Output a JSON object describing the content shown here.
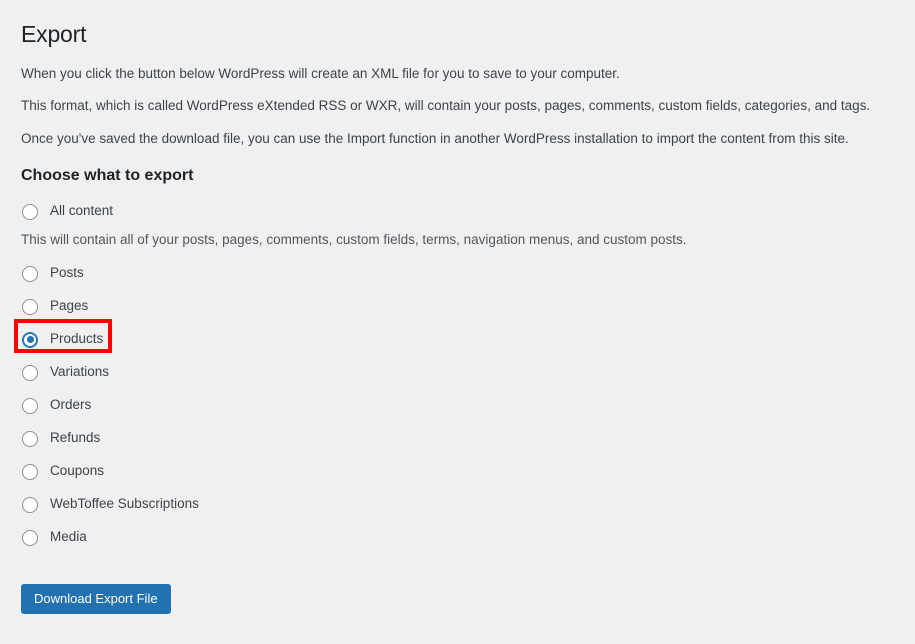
{
  "page": {
    "title": "Export",
    "intro_paragraphs": [
      "When you click the button below WordPress will create an XML file for you to save to your computer.",
      "This format, which is called WordPress eXtended RSS or WXR, will contain your posts, pages, comments, custom fields, categories, and tags.",
      "Once you've saved the download file, you can use the Import function in another WordPress installation to import the content from this site."
    ],
    "section_title": "Choose what to export",
    "all_content_description": "This will contain all of your posts, pages, comments, custom fields, terms, navigation menus, and custom posts.",
    "download_button_label": "Download Export File"
  },
  "options": [
    {
      "label": "All content",
      "selected": false
    },
    {
      "label": "Posts",
      "selected": false
    },
    {
      "label": "Pages",
      "selected": false
    },
    {
      "label": "Products",
      "selected": true
    },
    {
      "label": "Variations",
      "selected": false
    },
    {
      "label": "Orders",
      "selected": false
    },
    {
      "label": "Refunds",
      "selected": false
    },
    {
      "label": "Coupons",
      "selected": false
    },
    {
      "label": "WebToffee Subscriptions",
      "selected": false
    },
    {
      "label": "Media",
      "selected": false
    }
  ],
  "colors": {
    "background": "#f0f0f1",
    "accent": "#2271b1",
    "heading": "#1d2327",
    "body_text": "#3c434a",
    "highlight": "#ff0000",
    "radio_border": "#8c8f94"
  },
  "annotation": {
    "highlighted_option": "Products"
  }
}
